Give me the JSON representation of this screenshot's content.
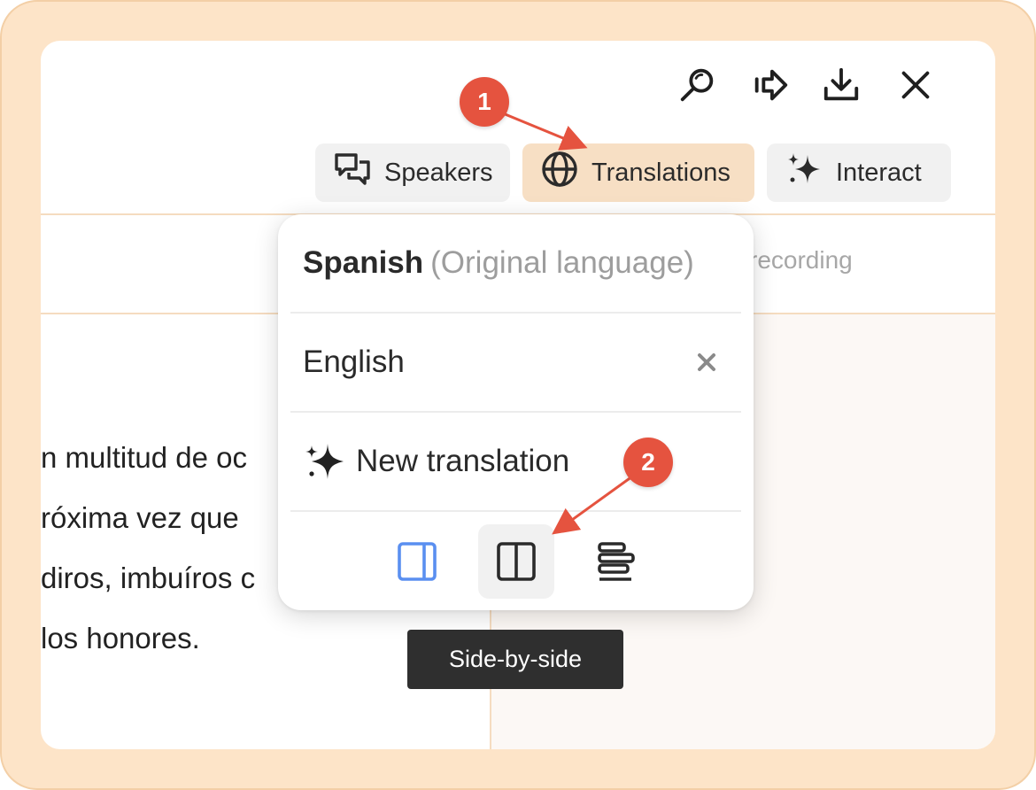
{
  "toolbar": {
    "icons": [
      "search-icon",
      "share-icon",
      "download-icon",
      "close-icon"
    ]
  },
  "tabs": [
    {
      "label": "Speakers",
      "icon": "speech-bubbles-icon",
      "active": false
    },
    {
      "label": "Translations",
      "icon": "globe-icon",
      "active": true
    },
    {
      "label": "Interact",
      "icon": "sparkles-icon",
      "active": false
    }
  ],
  "header_right_text": "recording",
  "transcript_lines": [
    "n multitud de oc",
    "róxima vez que",
    "diros, imbuíros c",
    " los honores."
  ],
  "translations_menu": {
    "original": {
      "language": "Spanish",
      "note": "(Original language)"
    },
    "items": [
      {
        "language": "English",
        "removable": true
      }
    ],
    "new_translation_label": "New translation",
    "view_modes": [
      {
        "name": "sidebar-view",
        "selected": true
      },
      {
        "name": "side-by-side-view",
        "hovered": true
      },
      {
        "name": "inline-view"
      }
    ]
  },
  "tooltip": "Side-by-side",
  "annotations": {
    "badge_1": "1",
    "badge_2": "2"
  },
  "colors": {
    "frame": "#fde4c8",
    "active_tab": "#f7dfc4",
    "badge": "#e5533f",
    "selected_view_icon": "#5a8ff0",
    "tooltip_bg": "#2f2f2f"
  }
}
